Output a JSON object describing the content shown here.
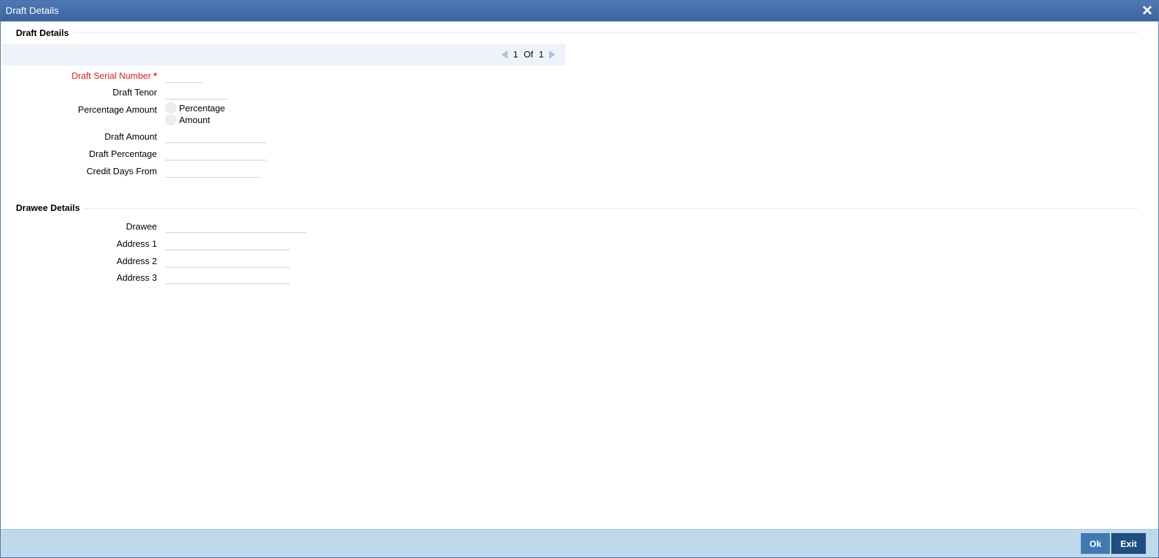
{
  "window": {
    "title": "Draft Details",
    "close_icon": "✕"
  },
  "draft_section": {
    "heading": "Draft Details",
    "pager": {
      "current": "1",
      "of_label": "Of",
      "total": "1"
    },
    "fields": {
      "serial_number": {
        "label": "Draft Serial Number",
        "required_mark": "*",
        "value": ""
      },
      "tenor": {
        "label": "Draft Tenor",
        "value": ""
      },
      "percentage_amount": {
        "label": "Percentage Amount",
        "options": [
          "Percentage",
          "Amount"
        ]
      },
      "draft_amount": {
        "label": "Draft Amount",
        "value": ""
      },
      "draft_percentage": {
        "label": "Draft Percentage",
        "value": ""
      },
      "credit_days_from": {
        "label": "Credit Days From",
        "value": ""
      }
    }
  },
  "drawee_section": {
    "heading": "Drawee Details",
    "fields": {
      "drawee": {
        "label": "Drawee",
        "value": ""
      },
      "address1": {
        "label": "Address 1",
        "value": ""
      },
      "address2": {
        "label": "Address 2",
        "value": ""
      },
      "address3": {
        "label": "Address 3",
        "value": ""
      }
    }
  },
  "footer": {
    "ok_label": "Ok",
    "exit_label": "Exit"
  }
}
